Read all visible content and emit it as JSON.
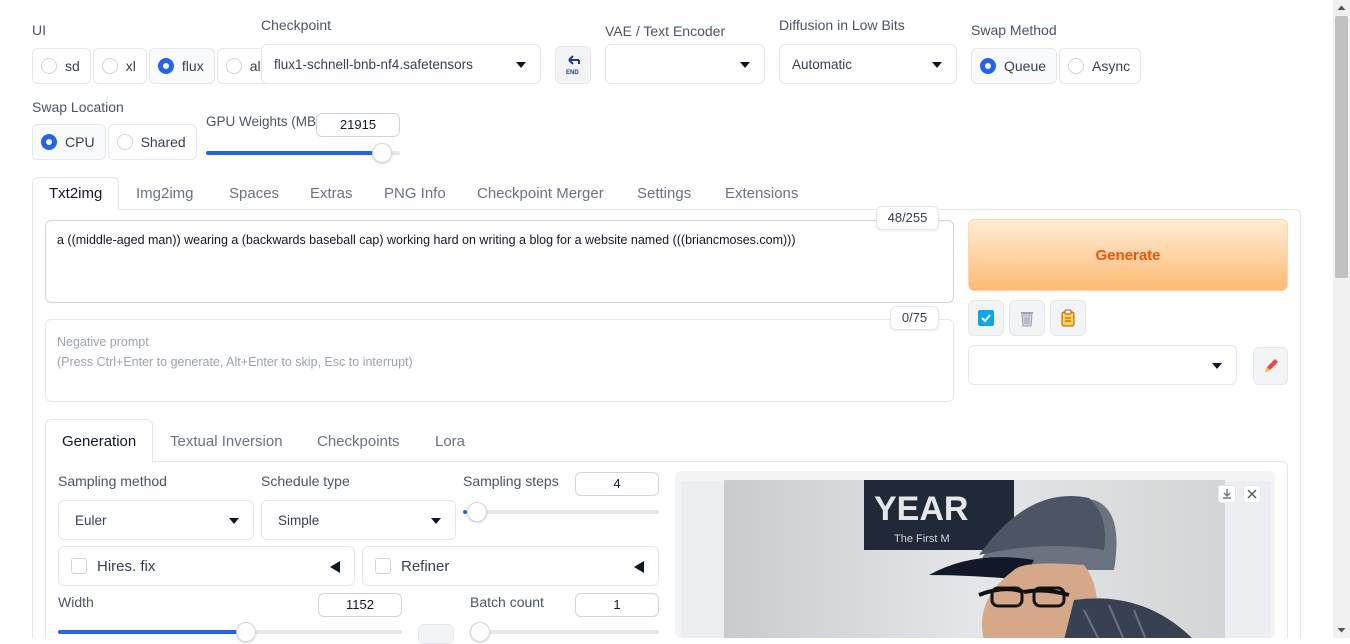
{
  "top": {
    "ui": {
      "label": "UI",
      "options": [
        "sd",
        "xl",
        "flux",
        "all"
      ],
      "selected": "flux"
    },
    "checkpoint": {
      "label": "Checkpoint",
      "value": "flux1-schnell-bnb-nf4.safetensors"
    },
    "vae": {
      "label": "VAE / Text Encoder",
      "value": ""
    },
    "diffusion": {
      "label": "Diffusion in Low Bits",
      "value": "Automatic"
    },
    "swap_method": {
      "label": "Swap Method",
      "options": [
        "Queue",
        "Async"
      ],
      "selected": "Queue"
    },
    "swap_location": {
      "label": "Swap Location",
      "options": [
        "CPU",
        "Shared"
      ],
      "selected": "CPU"
    },
    "gpu_weights": {
      "label": "GPU Weights (MB)",
      "value": "21915",
      "fraction": 0.9
    }
  },
  "tabs": [
    "Txt2img",
    "Img2img",
    "Spaces",
    "Extras",
    "PNG Info",
    "Checkpoint Merger",
    "Settings",
    "Extensions"
  ],
  "prompt": {
    "text": "a ((middle-aged man)) wearing a (backwards baseball cap)  working hard on writing a blog for a website named (((briancmoses.com)))",
    "counter": "48/255"
  },
  "negative": {
    "placeholder_line1": "Negative prompt",
    "placeholder_line2": "(Press Ctrl+Enter to generate, Alt+Enter to skip, Esc to interrupt)",
    "counter": "0/75"
  },
  "generate_label": "Generate",
  "subtabs": [
    "Generation",
    "Textual Inversion",
    "Checkpoints",
    "Lora"
  ],
  "gen": {
    "sampling_method": {
      "label": "Sampling method",
      "value": "Euler"
    },
    "schedule_type": {
      "label": "Schedule type",
      "value": "Simple"
    },
    "sampling_steps": {
      "label": "Sampling steps",
      "value": "4",
      "fraction": 0.02
    },
    "hires": "Hires. fix",
    "refiner": "Refiner",
    "width": {
      "label": "Width",
      "value": "1152",
      "fraction": 0.55
    },
    "batch_count": {
      "label": "Batch count",
      "value": "1",
      "fraction": 0.0
    }
  },
  "colors": {
    "accent": "#2563eb",
    "generate_bg": "#fdba74",
    "generate_text": "#ea580c"
  }
}
